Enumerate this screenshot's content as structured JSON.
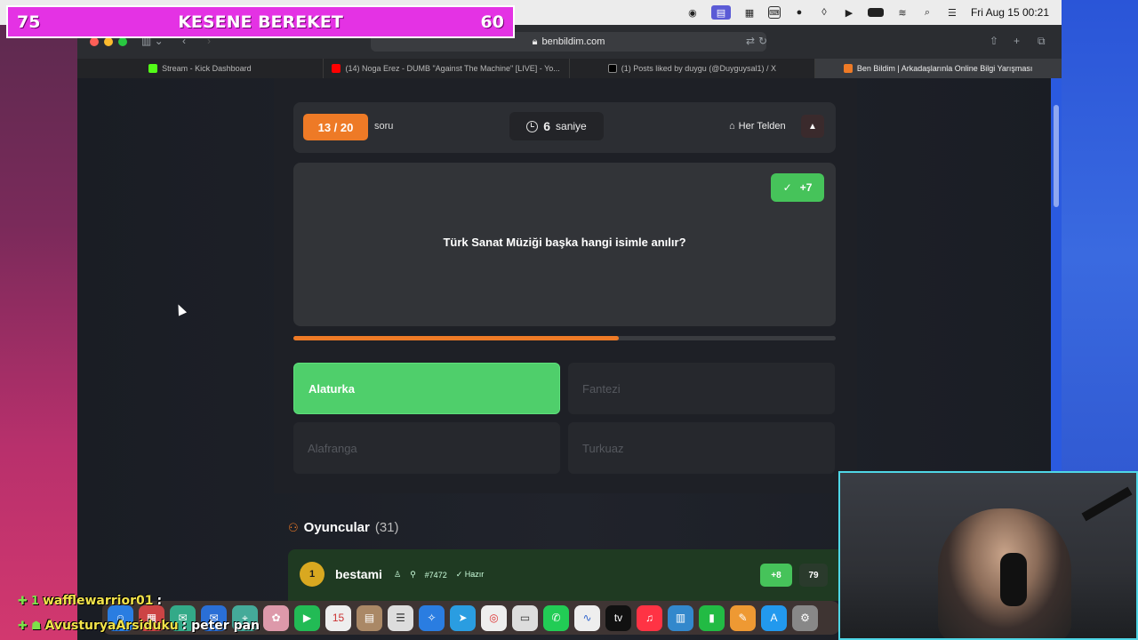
{
  "overlay": {
    "left_count": "75",
    "title": "KESENE BEREKET",
    "right_count": "60"
  },
  "menubar": {
    "clock": "Fri Aug 15  00:21"
  },
  "browser": {
    "url": "benbildim.com",
    "tabs": [
      {
        "label": "Stream - Kick Dashboard",
        "color": "#53fc18"
      },
      {
        "label": "(14) Noga Erez - DUMB \"Against The Machine\" [LIVE] - Yo...",
        "color": "#ff0000"
      },
      {
        "label": "(1) Posts liked by duygu (@Duyguysal1) / X",
        "color": "#000000"
      },
      {
        "label": "Ben Bildim | Arkadaşlarınla Online Bilgi Yarışması",
        "color": "#ee7a26"
      }
    ]
  },
  "quiz": {
    "question_counter": "13 / 20",
    "question_word": "soru",
    "timer_value": "6",
    "timer_unit": "saniye",
    "category": "Her Telden",
    "bonus": "+7",
    "question": "Türk Sanat Müziği başka hangi isimle anılır?",
    "progress": 0.6,
    "options": [
      {
        "label": "Alaturka",
        "state": "correct"
      },
      {
        "label": "Fantezi",
        "state": "dim"
      },
      {
        "label": "Alafranga",
        "state": "dim"
      },
      {
        "label": "Turkuaz",
        "state": "dim"
      }
    ]
  },
  "players": {
    "title": "Oyuncular",
    "count": "(31)",
    "list": [
      {
        "rank": "1",
        "name": "bestami",
        "tag": "#7472",
        "status": "Hazır",
        "delta": "+8",
        "score": "79"
      }
    ]
  },
  "chat": [
    {
      "user": "wafflewarrior01",
      "badge": "1",
      "message": ":"
    },
    {
      "user": "AvusturyaArsiduku",
      "badge": "",
      "message": ": peter pan"
    }
  ],
  "colors": {
    "accent": "#ee7a26",
    "correct": "#4fcf6b",
    "overlay": "#e432e4"
  }
}
